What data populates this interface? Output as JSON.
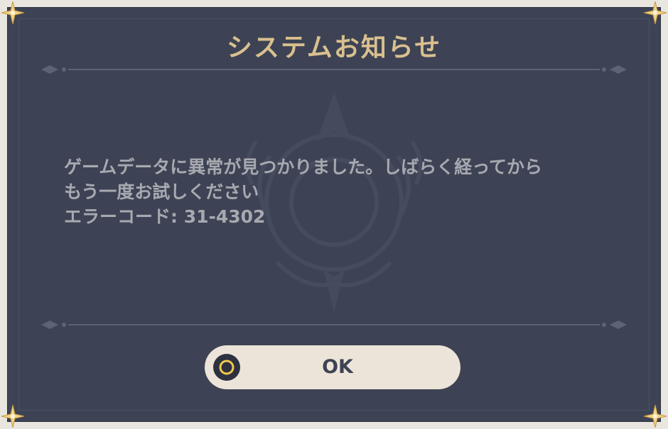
{
  "dialog": {
    "title": "システムお知らせ",
    "message_lines": [
      "ゲームデータに異常が見つかりました。しばらく経ってから",
      "もう一度お試しください",
      "エラーコード: 31-4302"
    ],
    "ok_label": "OK"
  },
  "colors": {
    "panel": "#3d4354",
    "title_gold": "#d9c08f",
    "message_text": "#a7a9b0",
    "button_bg": "#ece4d8"
  },
  "icons": {
    "ok_button_icon": "circle-confirm-icon",
    "corner_ornament": "star-corner-icon",
    "background_emblem": "emblem-watermark"
  }
}
